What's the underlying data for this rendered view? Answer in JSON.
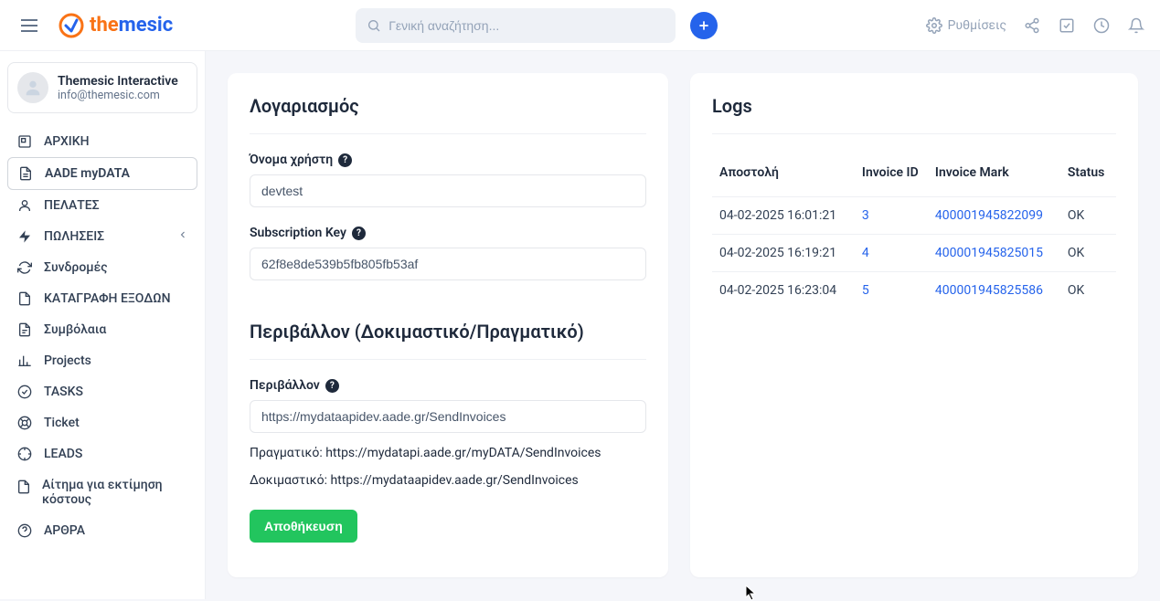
{
  "header": {
    "search_placeholder": "Γενική αναζήτηση...",
    "settings_label": "Ρυθμίσεις"
  },
  "user": {
    "name": "Themesic Interactive",
    "email": "info@themesic.com"
  },
  "sidebar": {
    "items": [
      {
        "label": "ΑΡΧΙΚΗ"
      },
      {
        "label": "AADE myDATA"
      },
      {
        "label": "ΠΕΛΑΤΕΣ"
      },
      {
        "label": "ΠΩΛΗΣΕΙΣ"
      },
      {
        "label": "Συνδρομές"
      },
      {
        "label": "ΚΑΤΑΓΡΑΦΗ ΕΞΟΔΩΝ"
      },
      {
        "label": "Συμβόλαια"
      },
      {
        "label": "Projects"
      },
      {
        "label": "TASKS"
      },
      {
        "label": "Ticket"
      },
      {
        "label": "LEADS"
      },
      {
        "label": "Αίτημα για εκτίμηση κόστους"
      },
      {
        "label": "ΑΡΘΡΑ"
      }
    ]
  },
  "account": {
    "heading": "Λογαριασμός",
    "username_label": "Όνομα χρήστη",
    "username_value": "devtest",
    "subkey_label": "Subscription Key",
    "subkey_value": "62f8e8de539b5fb805fb53af",
    "env_heading": "Περιβάλλον (Δοκιμαστικό/Πραγματικό)",
    "env_label": "Περιβάλλον",
    "env_value": "https://mydataapidev.aade.gr/SendInvoices",
    "hint_real": "Πραγματικό: https://mydatapi.aade.gr/myDATA/SendInvoices",
    "hint_test": "Δοκιμαστικό: https://mydataapidev.aade.gr/SendInvoices",
    "save_label": "Αποθήκευση"
  },
  "logs": {
    "heading": "Logs",
    "cols": {
      "sent": "Αποστολή",
      "invoice_id": "Invoice ID",
      "mark": "Invoice Mark",
      "status": "Status"
    },
    "rows": [
      {
        "sent": "04-02-2025 16:01:21",
        "invoice_id": "3",
        "mark": "400001945822099",
        "status": "OK"
      },
      {
        "sent": "04-02-2025 16:19:21",
        "invoice_id": "4",
        "mark": "400001945825015",
        "status": "OK"
      },
      {
        "sent": "04-02-2025 16:23:04",
        "invoice_id": "5",
        "mark": "400001945825586",
        "status": "OK"
      }
    ]
  }
}
